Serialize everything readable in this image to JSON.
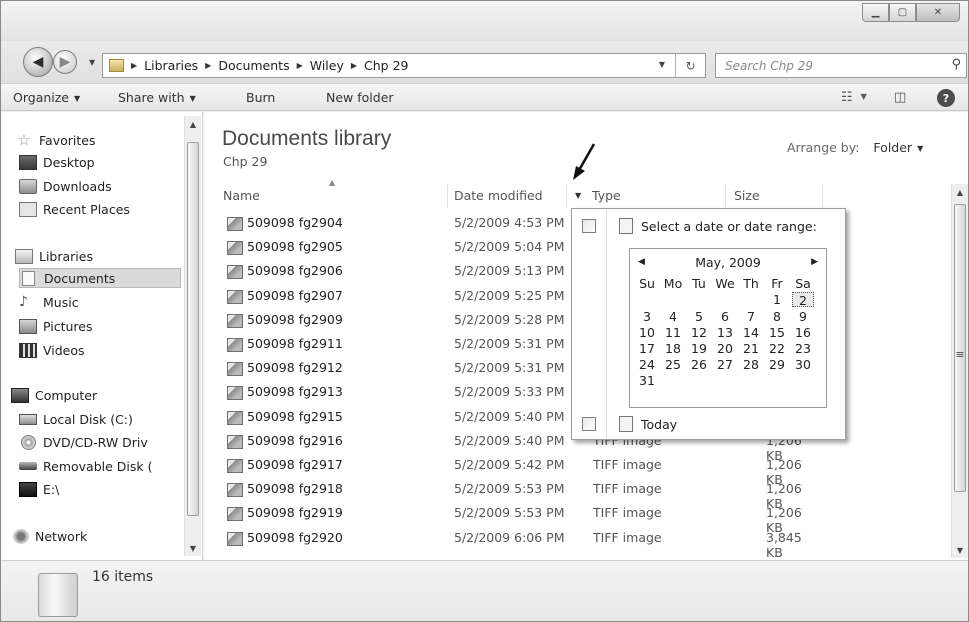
{
  "breadcrumb": [
    "Libraries",
    "Documents",
    "Wiley",
    "Chp 29"
  ],
  "search_placeholder": "Search Chp 29",
  "toolbar": {
    "organize": "Organize",
    "share_with": "Share with",
    "burn": "Burn",
    "new_folder": "New folder"
  },
  "nav": {
    "favorites": "Favorites",
    "desktop": "Desktop",
    "downloads": "Downloads",
    "recent_places": "Recent Places",
    "libraries": "Libraries",
    "documents": "Documents",
    "music": "Music",
    "pictures": "Pictures",
    "videos": "Videos",
    "computer": "Computer",
    "local_disk": "Local Disk (C:)",
    "dvd": "DVD/CD-RW Driv",
    "removable": "Removable Disk (",
    "e_drive": "E:\\",
    "network": "Network"
  },
  "library": {
    "title": "Documents library",
    "subtitle": "Chp 29",
    "arrange_label": "Arrange by:",
    "arrange_value": "Folder"
  },
  "columns": {
    "name": "Name",
    "date": "Date modified",
    "type": "Type",
    "size": "Size"
  },
  "files": [
    {
      "name": "509098 fg2904",
      "date": "5/2/2009 4:53 PM",
      "type": "",
      "size": ""
    },
    {
      "name": "509098 fg2905",
      "date": "5/2/2009 5:04 PM",
      "type": "",
      "size": ""
    },
    {
      "name": "509098 fg2906",
      "date": "5/2/2009 5:13 PM",
      "type": "",
      "size": ""
    },
    {
      "name": "509098 fg2907",
      "date": "5/2/2009 5:25 PM",
      "type": "",
      "size": ""
    },
    {
      "name": "509098 fg2909",
      "date": "5/2/2009 5:28 PM",
      "type": "",
      "size": ""
    },
    {
      "name": "509098 fg2911",
      "date": "5/2/2009 5:31 PM",
      "type": "",
      "size": ""
    },
    {
      "name": "509098 fg2912",
      "date": "5/2/2009 5:31 PM",
      "type": "",
      "size": ""
    },
    {
      "name": "509098 fg2913",
      "date": "5/2/2009 5:33 PM",
      "type": "",
      "size": ""
    },
    {
      "name": "509098 fg2915",
      "date": "5/2/2009 5:40 PM",
      "type": "",
      "size": ""
    },
    {
      "name": "509098 fg2916",
      "date": "5/2/2009 5:40 PM",
      "type": "TIFF image",
      "size": "1,206 KB"
    },
    {
      "name": "509098 fg2917",
      "date": "5/2/2009 5:42 PM",
      "type": "TIFF image",
      "size": "1,206 KB"
    },
    {
      "name": "509098 fg2918",
      "date": "5/2/2009 5:53 PM",
      "type": "TIFF image",
      "size": "1,206 KB"
    },
    {
      "name": "509098 fg2919",
      "date": "5/2/2009 5:53 PM",
      "type": "TIFF image",
      "size": "1,206 KB"
    },
    {
      "name": "509098 fg2920",
      "date": "5/2/2009 6:06 PM",
      "type": "TIFF image",
      "size": "3,845 KB"
    }
  ],
  "date_filter": {
    "select_label": "Select a date or date range:",
    "month": "May, 2009",
    "weekdays": [
      "Su",
      "Mo",
      "Tu",
      "We",
      "Th",
      "Fr",
      "Sa"
    ],
    "weeks": [
      [
        "",
        "",
        "",
        "",
        "",
        "1",
        "2"
      ],
      [
        "3",
        "4",
        "5",
        "6",
        "7",
        "8",
        "9"
      ],
      [
        "10",
        "11",
        "12",
        "13",
        "14",
        "15",
        "16"
      ],
      [
        "17",
        "18",
        "19",
        "20",
        "21",
        "22",
        "23"
      ],
      [
        "24",
        "25",
        "26",
        "27",
        "28",
        "29",
        "30"
      ],
      [
        "31",
        "",
        "",
        "",
        "",
        "",
        ""
      ]
    ],
    "highlighted_day": "2",
    "today_label": "Today"
  },
  "status": {
    "count": "16 items"
  }
}
